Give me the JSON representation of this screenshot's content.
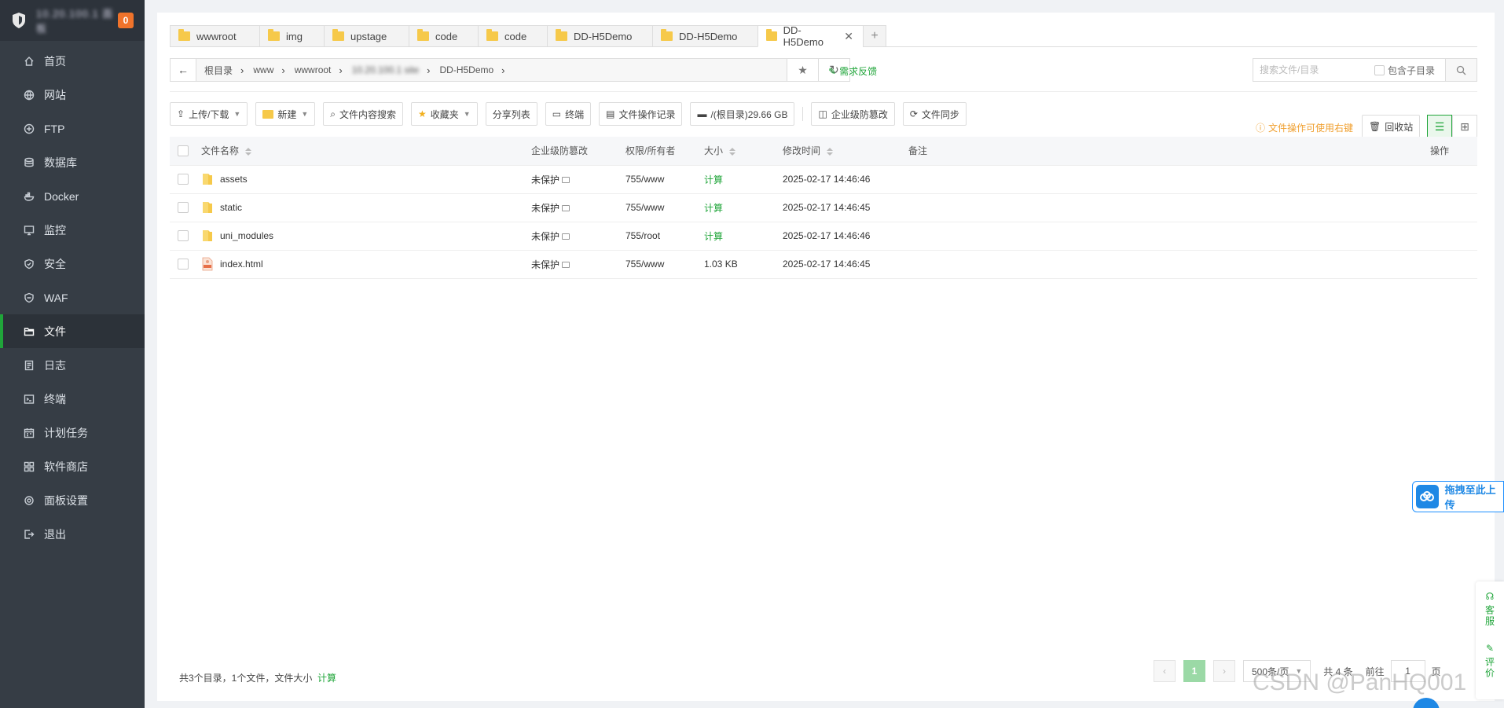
{
  "sidebar": {
    "brand": "10.20.100.1 面板",
    "notification_count": "0",
    "items": [
      {
        "label": "首页",
        "icon": "home-icon"
      },
      {
        "label": "网站",
        "icon": "globe-icon"
      },
      {
        "label": "FTP",
        "icon": "ftp-icon"
      },
      {
        "label": "数据库",
        "icon": "database-icon"
      },
      {
        "label": "Docker",
        "icon": "docker-icon"
      },
      {
        "label": "监控",
        "icon": "monitor-icon"
      },
      {
        "label": "安全",
        "icon": "shield-icon"
      },
      {
        "label": "WAF",
        "icon": "waf-icon"
      },
      {
        "label": "文件",
        "icon": "folder-icon",
        "active": true
      },
      {
        "label": "日志",
        "icon": "log-icon"
      },
      {
        "label": "终端",
        "icon": "terminal-icon"
      },
      {
        "label": "计划任务",
        "icon": "calendar-icon"
      },
      {
        "label": "软件商店",
        "icon": "apps-icon"
      },
      {
        "label": "面板设置",
        "icon": "gear-icon"
      },
      {
        "label": "退出",
        "icon": "logout-icon"
      }
    ]
  },
  "tabs": [
    {
      "label": "wwwroot"
    },
    {
      "label": "img"
    },
    {
      "label": "upstage"
    },
    {
      "label": "code"
    },
    {
      "label": "code"
    },
    {
      "label": "DD-H5Demo"
    },
    {
      "label": "DD-H5Demo"
    },
    {
      "label": "DD-H5Demo",
      "active": true
    }
  ],
  "path": {
    "crumbs": [
      "根目录",
      "www",
      "wwwroot",
      "10.20.100.1 site",
      "DD-H5Demo"
    ],
    "feedback": "需求反馈"
  },
  "search": {
    "placeholder": "搜索文件/目录",
    "include_sub": "包含子目录"
  },
  "toolbar": {
    "upload": "上传/下载",
    "new": "新建",
    "content_search": "文件内容搜索",
    "favorites": "收藏夹",
    "share_list": "分享列表",
    "terminal": "终端",
    "op_log": "文件操作记录",
    "disk": "/(根目录)29.66 GB",
    "tamper": "企业级防篡改",
    "sync": "文件同步",
    "tip": "文件操作可使用右键",
    "recycle": "回收站"
  },
  "table": {
    "headers": {
      "name": "文件名称",
      "tamper": "企业级防篡改",
      "perm": "权限/所有者",
      "size": "大小",
      "mtime": "修改时间",
      "note": "备注",
      "ops": "操作"
    },
    "rows": [
      {
        "name": "assets",
        "type": "folder",
        "tamper": "未保护",
        "perm": "755/www",
        "size": "计算",
        "mtime": "2025-02-17 14:46:46"
      },
      {
        "name": "static",
        "type": "folder",
        "tamper": "未保护",
        "perm": "755/www",
        "size": "计算",
        "mtime": "2025-02-17 14:46:45"
      },
      {
        "name": "uni_modules",
        "type": "folder",
        "tamper": "未保护",
        "perm": "755/root",
        "size": "计算",
        "mtime": "2025-02-17 14:46:46"
      },
      {
        "name": "index.html",
        "type": "html",
        "tamper": "未保护",
        "perm": "755/www",
        "size": "1.03 KB",
        "mtime": "2025-02-17 14:46:45"
      }
    ]
  },
  "footer": {
    "summary": "共3个目录，1个文件，文件大小",
    "calc": "计算",
    "current_page": "1",
    "per_page": "500条/页",
    "total": "共 4 条",
    "goto": "前往",
    "goto_value": "1",
    "page_unit": "页"
  },
  "float": {
    "upload_drop": "拖拽至此上传",
    "service": "客服",
    "survey": "评价"
  },
  "watermark": "CSDN @PanHQ001",
  "colors": {
    "accent": "#20a53a",
    "sidebar": "#363d45",
    "tip": "#f0a030"
  }
}
